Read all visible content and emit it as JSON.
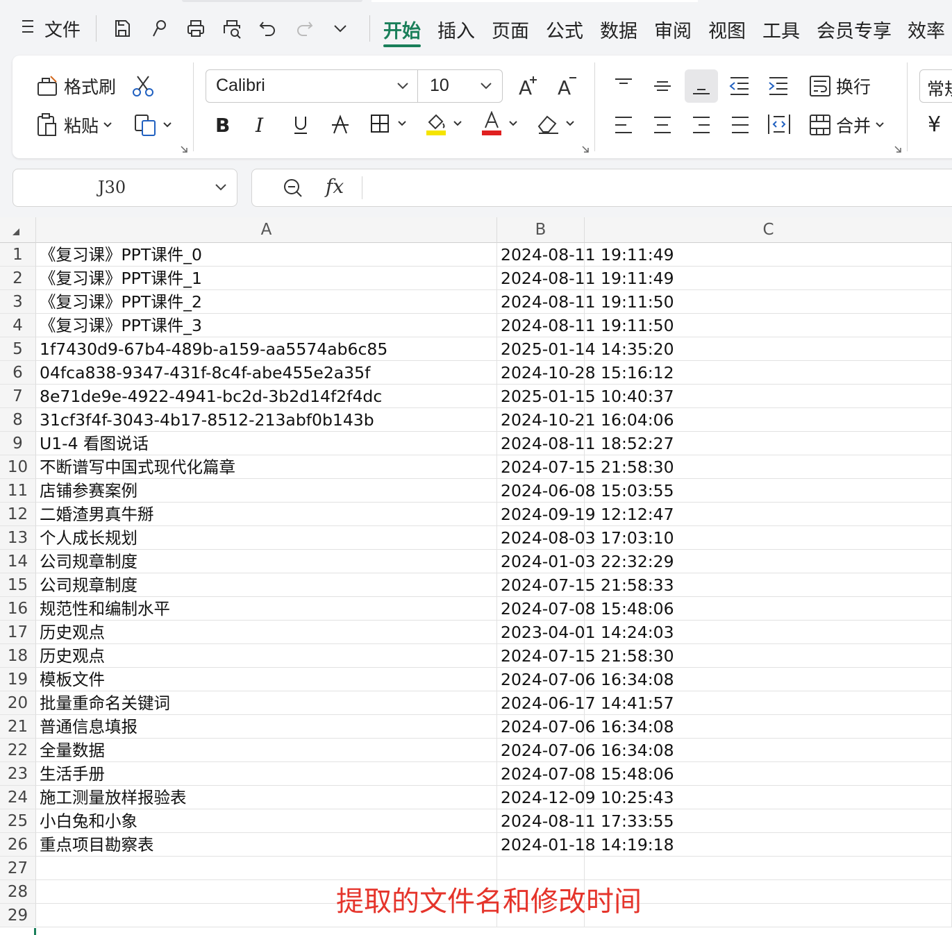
{
  "menubar": {
    "menu_label": "文件",
    "tabs": [
      {
        "label": "开始",
        "active": true
      },
      {
        "label": "插入",
        "active": false
      },
      {
        "label": "页面",
        "active": false
      },
      {
        "label": "公式",
        "active": false
      },
      {
        "label": "数据",
        "active": false
      },
      {
        "label": "审阅",
        "active": false
      },
      {
        "label": "视图",
        "active": false
      },
      {
        "label": "工具",
        "active": false
      },
      {
        "label": "会员专享",
        "active": false
      },
      {
        "label": "效率",
        "active": false
      }
    ],
    "quick_icons": [
      "save-icon",
      "format-brush-quick-icon",
      "print-icon",
      "print-preview-icon",
      "undo-icon",
      "redo-icon",
      "more-chevron-icon"
    ]
  },
  "ribbon": {
    "format_painter_label": "格式刷",
    "paste_label": "粘贴",
    "font_name": "Calibri",
    "font_size": "10",
    "wrap_label": "换行",
    "merge_label": "合并",
    "number_format_partial": "常规",
    "currency_partial": "¥"
  },
  "formula_bar": {
    "cell_ref": "J30",
    "fx_label": "fx",
    "content": ""
  },
  "sheet": {
    "columns": [
      "A",
      "B",
      "C"
    ],
    "rows": [
      {
        "num": "1",
        "a": "《复习课》PPT课件_0",
        "b": "2024-08-11 19:11:49"
      },
      {
        "num": "2",
        "a": "《复习课》PPT课件_1",
        "b": "2024-08-11 19:11:49"
      },
      {
        "num": "3",
        "a": "《复习课》PPT课件_2",
        "b": "2024-08-11 19:11:50"
      },
      {
        "num": "4",
        "a": "《复习课》PPT课件_3",
        "b": "2024-08-11 19:11:50"
      },
      {
        "num": "5",
        "a": "1f7430d9-67b4-489b-a159-aa5574ab6c85",
        "b": "2025-01-14 14:35:20"
      },
      {
        "num": "6",
        "a": "04fca838-9347-431f-8c4f-abe455e2a35f",
        "b": "2024-10-28 15:16:12"
      },
      {
        "num": "7",
        "a": "8e71de9e-4922-4941-bc2d-3b2d14f2f4dc",
        "b": "2025-01-15 10:40:37"
      },
      {
        "num": "8",
        "a": "31cf3f4f-3043-4b17-8512-213abf0b143b",
        "b": "2024-10-21 16:04:06"
      },
      {
        "num": "9",
        "a": "U1-4 看图说话",
        "b": "2024-08-11 18:52:27"
      },
      {
        "num": "10",
        "a": "不断谱写中国式现代化篇章",
        "b": "2024-07-15 21:58:30"
      },
      {
        "num": "11",
        "a": "店铺参赛案例",
        "b": "2024-06-08 15:03:55"
      },
      {
        "num": "12",
        "a": "二婚渣男真牛掰",
        "b": "2024-09-19 12:12:47"
      },
      {
        "num": "13",
        "a": "个人成长规划",
        "b": "2024-08-03 17:03:10"
      },
      {
        "num": "14",
        "a": "公司规章制度",
        "b": "2024-01-03 22:32:29"
      },
      {
        "num": "15",
        "a": "公司规章制度",
        "b": "2024-07-15 21:58:33"
      },
      {
        "num": "16",
        "a": "规范性和编制水平",
        "b": "2024-07-08 15:48:06"
      },
      {
        "num": "17",
        "a": "历史观点",
        "b": "2023-04-01 14:24:03"
      },
      {
        "num": "18",
        "a": "历史观点",
        "b": "2024-07-15 21:58:30"
      },
      {
        "num": "19",
        "a": "模板文件",
        "b": "2024-07-06 16:34:08"
      },
      {
        "num": "20",
        "a": "批量重命名关键词",
        "b": "2024-06-17 14:41:57"
      },
      {
        "num": "21",
        "a": "普通信息填报",
        "b": "2024-07-06 16:34:08"
      },
      {
        "num": "22",
        "a": "全量数据",
        "b": "2024-07-06 16:34:08"
      },
      {
        "num": "23",
        "a": "生活手册",
        "b": "2024-07-08 15:48:06"
      },
      {
        "num": "24",
        "a": "施工测量放样报验表",
        "b": "2024-12-09 10:25:43"
      },
      {
        "num": "25",
        "a": "小白兔和小象",
        "b": "2024-08-11 17:33:55"
      },
      {
        "num": "26",
        "a": "重点项目勘察表",
        "b": "2024-01-18 14:19:18"
      },
      {
        "num": "27",
        "a": "",
        "b": ""
      },
      {
        "num": "28",
        "a": "",
        "b": ""
      },
      {
        "num": "29",
        "a": "",
        "b": ""
      }
    ]
  },
  "annotation": "提取的文件名和修改时间",
  "colors": {
    "accent": "#1a7f5a",
    "annotation": "#e5342b",
    "highlight": "#f5e400",
    "font_color": "#e02020"
  }
}
